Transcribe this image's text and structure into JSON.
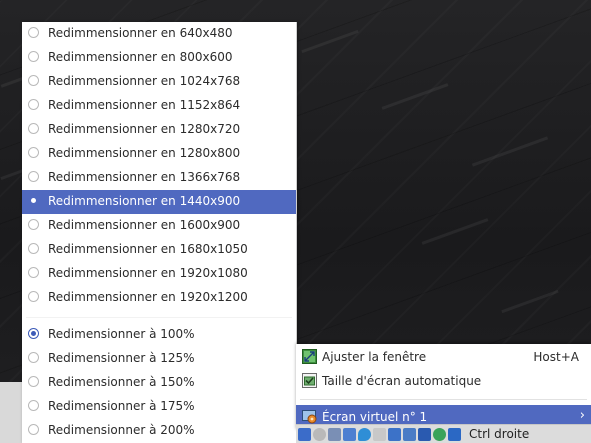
{
  "resize_menu": {
    "items": [
      {
        "label": "Redimmensionner en 640x480",
        "state": "off"
      },
      {
        "label": "Redimmensionner en 800x600",
        "state": "off"
      },
      {
        "label": "Redimmensionner en 1024x768",
        "state": "off"
      },
      {
        "label": "Redimmensionner en 1152x864",
        "state": "off"
      },
      {
        "label": "Redimmensionner en 1280x720",
        "state": "off"
      },
      {
        "label": "Redimmensionner en 1280x800",
        "state": "off"
      },
      {
        "label": "Redimmensionner en 1366x768",
        "state": "off"
      },
      {
        "label": "Redimmensionner en 1440x900",
        "state": "highlighted"
      },
      {
        "label": "Redimmensionner en 1600x900",
        "state": "off"
      },
      {
        "label": "Redimmensionner en 1680x1050",
        "state": "off"
      },
      {
        "label": "Redimmensionner en 1920x1080",
        "state": "off"
      },
      {
        "label": "Redimmensionner en 1920x1200",
        "state": "off"
      }
    ],
    "scale_items": [
      {
        "label": "Redimensionner à 100%",
        "state": "checked"
      },
      {
        "label": "Redimensionner à 125%",
        "state": "off"
      },
      {
        "label": "Redimensionner à 150%",
        "state": "off"
      },
      {
        "label": "Redimensionner à 175%",
        "state": "off"
      },
      {
        "label": "Redimensionner à 200%",
        "state": "off"
      }
    ]
  },
  "view_menu": {
    "adjust_window": {
      "label": "Ajuster la fenêtre",
      "shortcut": "Host+A",
      "icon": "resize-window-icon"
    },
    "auto_resize": {
      "label": "Taille d'écran automatique",
      "icon": "auto-resize-checkbox-icon"
    },
    "virtual_screen": {
      "label": "Écran virtuel n° 1",
      "icon": "virtual-screen-icon",
      "submenu_arrow": "›"
    }
  },
  "statusbar": {
    "host_key": "Ctrl droite",
    "icons": [
      "disk-icon",
      "optical-icon",
      "audio-icon",
      "network-icon",
      "usb-icon",
      "shared-folder-icon",
      "display-icon",
      "recording-icon",
      "cpu-icon",
      "mouse-integration-icon",
      "keyboard-icon"
    ]
  },
  "colors": {
    "highlight": "#5069c0",
    "desktop": "#1b1b1d",
    "menu_bg": "#ffffff"
  }
}
